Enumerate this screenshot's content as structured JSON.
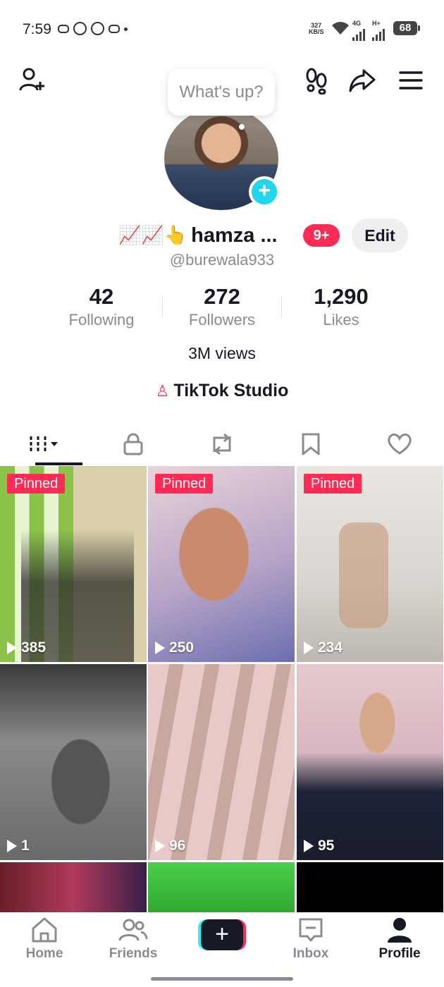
{
  "status_bar": {
    "time": "7:59",
    "speed_top": "327",
    "speed_bottom": "KB/S",
    "net1": "4G",
    "net2": "H+",
    "battery": "68"
  },
  "profile": {
    "bubble_text": "What's up?",
    "name_emojis": "📈📈👆",
    "name": "hamza ...",
    "notif_badge": "9+",
    "edit_label": "Edit",
    "handle": "@burewala933",
    "stats": [
      {
        "value": "42",
        "label": "Following"
      },
      {
        "value": "272",
        "label": "Followers"
      },
      {
        "value": "1,290",
        "label": "Likes"
      }
    ],
    "views": "3M views",
    "studio_label": "TikTok Studio"
  },
  "tabs": [
    "videos-icon",
    "lock-icon",
    "repost-icon",
    "bookmark-icon",
    "heart-icon"
  ],
  "videos": [
    {
      "pinned": "Pinned",
      "views": "385"
    },
    {
      "pinned": "Pinned",
      "views": "250"
    },
    {
      "pinned": "Pinned",
      "views": "234"
    },
    {
      "views": "1"
    },
    {
      "views": "96"
    },
    {
      "views": "95"
    }
  ],
  "nav": {
    "home": "Home",
    "friends": "Friends",
    "inbox": "Inbox",
    "profile": "Profile"
  },
  "colors": {
    "accent": "#fe2c55",
    "cyan": "#20d5ec"
  }
}
